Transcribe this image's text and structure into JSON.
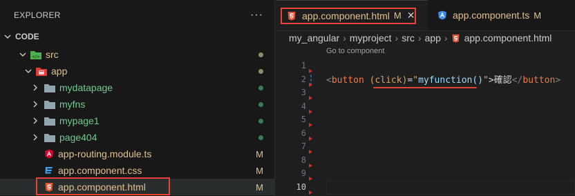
{
  "explorer": {
    "title": "EXPLORER",
    "more_label": "···",
    "section": "CODE",
    "items": [
      {
        "label": "src",
        "status": "dot",
        "color": "#e2c08d"
      },
      {
        "label": "app",
        "status": "dot",
        "color": "#e2c08d"
      },
      {
        "label": "mydatapage",
        "status": "dot",
        "color": "#73c991"
      },
      {
        "label": "myfns",
        "status": "dot",
        "color": "#73c991"
      },
      {
        "label": "mypage1",
        "status": "dot",
        "color": "#73c991"
      },
      {
        "label": "page404",
        "status": "dot",
        "color": "#73c991"
      },
      {
        "label": "app-routing.module.ts",
        "status": "M"
      },
      {
        "label": "app.component.css",
        "status": "M"
      },
      {
        "label": "app.component.html",
        "status": "M"
      }
    ]
  },
  "tabs": [
    {
      "label": "app.component.html",
      "modified": "M",
      "close": "✕",
      "active": true
    },
    {
      "label": "app.component.ts",
      "modified": "M",
      "active": false
    }
  ],
  "breadcrumb": [
    "my_angular",
    "myproject",
    "src",
    "app",
    "app.component.html"
  ],
  "codelens": "Go to component",
  "line_numbers": [
    "1",
    "2",
    "3",
    "4",
    "5",
    "6",
    "7",
    "8",
    "9",
    "10"
  ],
  "code": {
    "open_bracket": "<",
    "tag": "button",
    "attr": "(click)",
    "equals": "=",
    "quote_open": "\"",
    "fn": "myfunction()",
    "quote_close": "\"",
    "close_bracket": ">",
    "text": "確認",
    "end_open": "</",
    "end_tag": "button",
    "end_close": ">"
  },
  "colors": {
    "accent_red": "#e8433a",
    "modified": "#e2c08d",
    "untracked": "#73c991",
    "html_icon": "#e65131",
    "angular_icon": "#dd0031",
    "ts_tab_icon": "#3b8eea",
    "css_icon": "#42a5f5"
  }
}
